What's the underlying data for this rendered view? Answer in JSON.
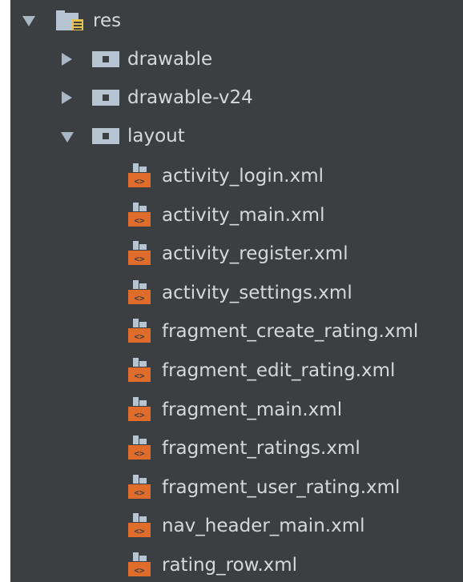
{
  "tree": {
    "root": {
      "label": "res",
      "icon": "resource-folder-icon",
      "expanded": true
    },
    "folders": [
      {
        "label": "drawable",
        "icon": "folder-icon",
        "expanded": false
      },
      {
        "label": "drawable-v24",
        "icon": "folder-icon",
        "expanded": false
      },
      {
        "label": "layout",
        "icon": "folder-icon",
        "expanded": true
      }
    ],
    "files": [
      {
        "label": "activity_login.xml",
        "icon": "xml-layout-file-icon"
      },
      {
        "label": "activity_main.xml",
        "icon": "xml-layout-file-icon"
      },
      {
        "label": "activity_register.xml",
        "icon": "xml-layout-file-icon"
      },
      {
        "label": "activity_settings.xml",
        "icon": "xml-layout-file-icon"
      },
      {
        "label": "fragment_create_rating.xml",
        "icon": "xml-layout-file-icon"
      },
      {
        "label": "fragment_edit_rating.xml",
        "icon": "xml-layout-file-icon"
      },
      {
        "label": "fragment_main.xml",
        "icon": "xml-layout-file-icon"
      },
      {
        "label": "fragment_ratings.xml",
        "icon": "xml-layout-file-icon"
      },
      {
        "label": "fragment_user_rating.xml",
        "icon": "xml-layout-file-icon"
      },
      {
        "label": "nav_header_main.xml",
        "icon": "xml-layout-file-icon"
      },
      {
        "label": "rating_row.xml",
        "icon": "xml-layout-file-icon"
      }
    ]
  },
  "colors": {
    "background": "#3c3f41",
    "text": "#d6d8da",
    "arrow": "#a9b7c6",
    "folder": "#b6c5d1",
    "xml_icon": "#e06c2c"
  }
}
